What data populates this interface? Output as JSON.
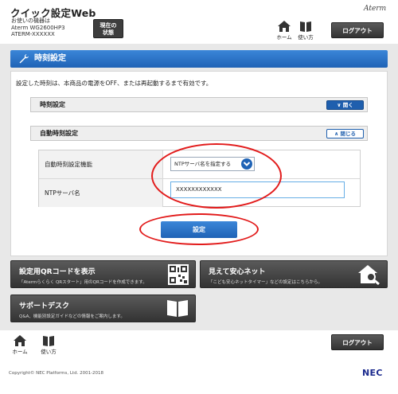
{
  "header": {
    "title": "クイック設定Web",
    "model_label": "お使いの機器は",
    "model_name": "Aterm WG2600HP3",
    "device_id": "ATERM-XXXXXX",
    "status_button_line1": "現在の",
    "status_button_line2": "状態",
    "brand": "Aterm",
    "home_label": "ホーム",
    "help_label": "使い方",
    "logout_label": "ログアウト"
  },
  "section": {
    "title": "時刻設定",
    "notice": "設定した時刻は、本商品の電源をOFF、または再起動するまで有効です。"
  },
  "accordions": [
    {
      "title": "時刻設定",
      "button": "開く"
    },
    {
      "title": "自動時刻設定",
      "button": "閉じる"
    }
  ],
  "form": {
    "auto_time_label": "自動時刻設定機能",
    "auto_time_value": "NTPサーバ名を指定する",
    "ntp_label": "NTPサーバ名",
    "ntp_value": "XXXXXXXXXXXX",
    "submit_label": "設定"
  },
  "tiles": [
    {
      "title": "設定用QRコードを表示",
      "desc": "「Atermらくらく QRスタート」用のQRコードを作成できます。"
    },
    {
      "title": "見えて安心ネット",
      "desc": "「こども安心ネットタイマー」などの設定はこちらから。"
    },
    {
      "title": "サポートデスク",
      "desc": "Q&A、機能別設定ガイドなどの情報をご案内します。"
    }
  ],
  "footer": {
    "home_label": "ホーム",
    "help_label": "使い方",
    "logout_label": "ログアウト",
    "copyright": "Copyright© NEC Platforms, Ltd. 2001-2018",
    "logo": "NEC"
  },
  "colors": {
    "accent_blue": "#1f63b6",
    "highlight_red": "#e21b1b",
    "dark_button": "#3d3d3d"
  }
}
